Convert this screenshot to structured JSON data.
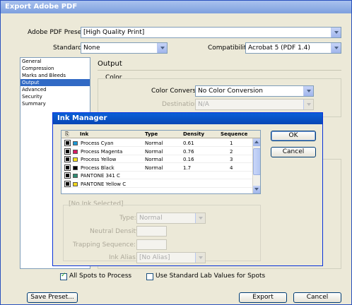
{
  "window": {
    "title": "Export Adobe PDF"
  },
  "preset": {
    "label": "Adobe PDF Preset:",
    "value": "[High Quality Print]"
  },
  "standard": {
    "label": "Standard:",
    "value": "None"
  },
  "compatibility": {
    "label": "Compatibility:",
    "value": "Acrobat 5 (PDF 1.4)"
  },
  "sidebar": {
    "items": [
      {
        "label": "General"
      },
      {
        "label": "Compression"
      },
      {
        "label": "Marks and Bleeds"
      },
      {
        "label": "Output",
        "selected": true
      },
      {
        "label": "Advanced"
      },
      {
        "label": "Security"
      },
      {
        "label": "Summary"
      }
    ]
  },
  "output": {
    "section_title": "Output",
    "color_group": "Color",
    "color_conversion_label": "Color Conversion:",
    "color_conversion_value": "No Color Conversion",
    "destination_label": "Destination:",
    "destination_value": "N/A"
  },
  "ink_manager": {
    "title": "Ink Manager",
    "columns": [
      "Ink",
      "Type",
      "Density",
      "Sequence"
    ],
    "inks": [
      {
        "name": "Process Cyan",
        "type": "Normal",
        "density": "0.61",
        "sequence": "1",
        "color": "#1e9ad6"
      },
      {
        "name": "Process Magenta",
        "type": "Normal",
        "density": "0.76",
        "sequence": "2",
        "color": "#d81b60"
      },
      {
        "name": "Process Yellow",
        "type": "Normal",
        "density": "0.16",
        "sequence": "3",
        "color": "#f7e11b"
      },
      {
        "name": "Process Black",
        "type": "Normal",
        "density": "1.7",
        "sequence": "4",
        "color": "#000000"
      },
      {
        "name": "PANTONE 341 C",
        "type": "",
        "density": "",
        "sequence": "",
        "color": "#2e8b72"
      },
      {
        "name": "PANTONE Yellow C",
        "type": "",
        "density": "",
        "sequence": "",
        "color": "#f4d81c"
      }
    ],
    "ok_label": "OK",
    "cancel_label": "Cancel",
    "no_ink_label": "[No Ink Selected]",
    "type_label": "Type:",
    "type_value": "Normal",
    "neutral_density_label": "Neutral Density:",
    "trapping_sequence_label": "Trapping Sequence:",
    "ink_alias_label": "Ink Alias:",
    "ink_alias_value": "[No Alias]",
    "all_spots_label": "All Spots to Process",
    "all_spots_checked": true,
    "lab_values_label": "Use Standard Lab Values for Spots",
    "lab_values_checked": false
  },
  "footer": {
    "save_preset_label": "Save Preset...",
    "export_label": "Export",
    "cancel_label": "Cancel"
  }
}
